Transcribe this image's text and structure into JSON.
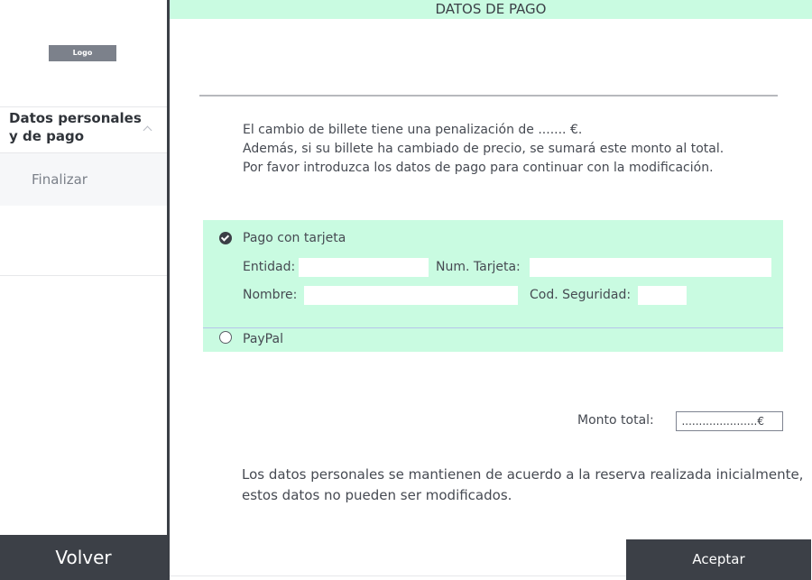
{
  "sidebar": {
    "logo_text": "Logo",
    "items": [
      {
        "label_line1": "Datos personales",
        "label_line2": "y de pago",
        "icon": "chevron-up-icon"
      },
      {
        "label": "Finalizar"
      }
    ],
    "back_label": "Volver"
  },
  "header": {
    "title": "DATOS DE PAGO"
  },
  "message": {
    "line1": "El cambio de billete tiene una penalización de ....... €.",
    "line2": "Además, si su billete ha cambiado de precio, se sumará este monto al total.",
    "line3": "Por favor introduzca los datos de pago para continuar con la modificación."
  },
  "payment": {
    "card_option": {
      "label": "Pago con tarjeta",
      "selected": true,
      "icon": "check-circle-icon",
      "fields": {
        "entidad_label": "Entidad:",
        "num_tarjeta_label": "Num. Tarjeta:",
        "nombre_label": "Nombre:",
        "cod_seguridad_label": "Cod. Seguridad:"
      }
    },
    "paypal_option": {
      "label": "PayPal",
      "selected": false
    }
  },
  "total": {
    "label": "Monto total:",
    "value": "......................€"
  },
  "note": {
    "line1": "Los datos personales se mantienen de acuerdo a la reserva realizada inicialmente,",
    "line2": "estos datos no pueden ser modificados."
  },
  "actions": {
    "accept_label": "Aceptar"
  },
  "colors": {
    "accent_panel": "#c9fbe1",
    "dark_button": "#3c4047"
  }
}
